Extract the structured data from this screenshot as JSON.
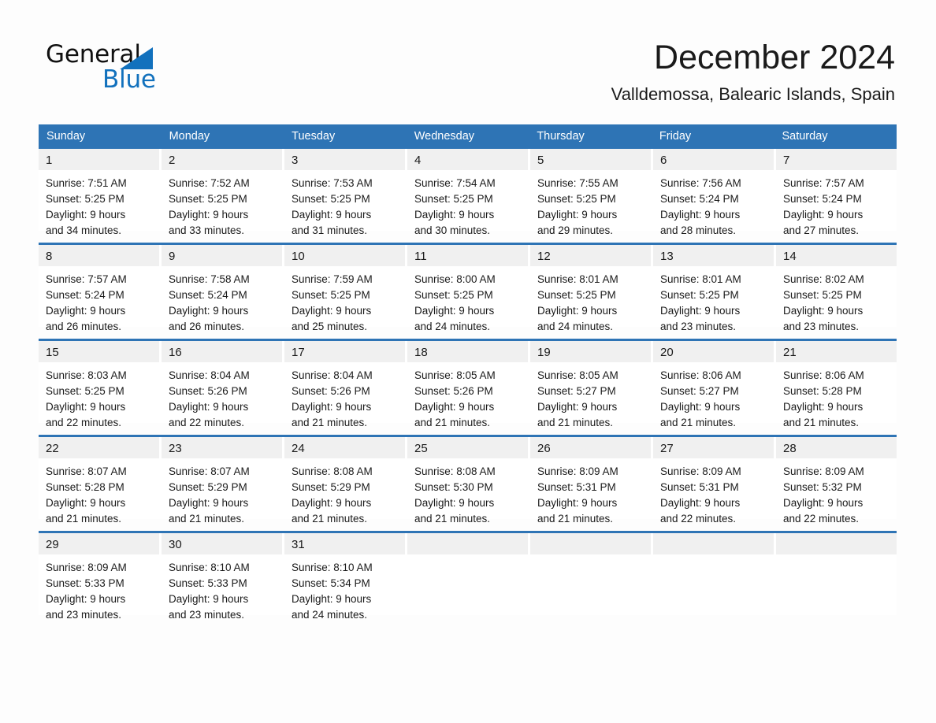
{
  "logo": {
    "text_primary": "General",
    "text_secondary": "Blue",
    "accent_color": "#1271bd",
    "triangle_icon": "triangle-icon"
  },
  "header": {
    "month_title": "December 2024",
    "location": "Valldemossa, Balearic Islands, Spain"
  },
  "colors": {
    "header_blue": "#2e74b5",
    "date_band_gray": "#f0f0f0",
    "page_background": "#fdfdfd",
    "text": "#1a1a1a"
  },
  "calendar": {
    "weekdays": [
      "Sunday",
      "Monday",
      "Tuesday",
      "Wednesday",
      "Thursday",
      "Friday",
      "Saturday"
    ],
    "weeks": [
      [
        {
          "date": "1",
          "sunrise": "Sunrise: 7:51 AM",
          "sunset": "Sunset: 5:25 PM",
          "daylight_line1": "Daylight: 9 hours",
          "daylight_line2": "and 34 minutes."
        },
        {
          "date": "2",
          "sunrise": "Sunrise: 7:52 AM",
          "sunset": "Sunset: 5:25 PM",
          "daylight_line1": "Daylight: 9 hours",
          "daylight_line2": "and 33 minutes."
        },
        {
          "date": "3",
          "sunrise": "Sunrise: 7:53 AM",
          "sunset": "Sunset: 5:25 PM",
          "daylight_line1": "Daylight: 9 hours",
          "daylight_line2": "and 31 minutes."
        },
        {
          "date": "4",
          "sunrise": "Sunrise: 7:54 AM",
          "sunset": "Sunset: 5:25 PM",
          "daylight_line1": "Daylight: 9 hours",
          "daylight_line2": "and 30 minutes."
        },
        {
          "date": "5",
          "sunrise": "Sunrise: 7:55 AM",
          "sunset": "Sunset: 5:25 PM",
          "daylight_line1": "Daylight: 9 hours",
          "daylight_line2": "and 29 minutes."
        },
        {
          "date": "6",
          "sunrise": "Sunrise: 7:56 AM",
          "sunset": "Sunset: 5:24 PM",
          "daylight_line1": "Daylight: 9 hours",
          "daylight_line2": "and 28 minutes."
        },
        {
          "date": "7",
          "sunrise": "Sunrise: 7:57 AM",
          "sunset": "Sunset: 5:24 PM",
          "daylight_line1": "Daylight: 9 hours",
          "daylight_line2": "and 27 minutes."
        }
      ],
      [
        {
          "date": "8",
          "sunrise": "Sunrise: 7:57 AM",
          "sunset": "Sunset: 5:24 PM",
          "daylight_line1": "Daylight: 9 hours",
          "daylight_line2": "and 26 minutes."
        },
        {
          "date": "9",
          "sunrise": "Sunrise: 7:58 AM",
          "sunset": "Sunset: 5:24 PM",
          "daylight_line1": "Daylight: 9 hours",
          "daylight_line2": "and 26 minutes."
        },
        {
          "date": "10",
          "sunrise": "Sunrise: 7:59 AM",
          "sunset": "Sunset: 5:25 PM",
          "daylight_line1": "Daylight: 9 hours",
          "daylight_line2": "and 25 minutes."
        },
        {
          "date": "11",
          "sunrise": "Sunrise: 8:00 AM",
          "sunset": "Sunset: 5:25 PM",
          "daylight_line1": "Daylight: 9 hours",
          "daylight_line2": "and 24 minutes."
        },
        {
          "date": "12",
          "sunrise": "Sunrise: 8:01 AM",
          "sunset": "Sunset: 5:25 PM",
          "daylight_line1": "Daylight: 9 hours",
          "daylight_line2": "and 24 minutes."
        },
        {
          "date": "13",
          "sunrise": "Sunrise: 8:01 AM",
          "sunset": "Sunset: 5:25 PM",
          "daylight_line1": "Daylight: 9 hours",
          "daylight_line2": "and 23 minutes."
        },
        {
          "date": "14",
          "sunrise": "Sunrise: 8:02 AM",
          "sunset": "Sunset: 5:25 PM",
          "daylight_line1": "Daylight: 9 hours",
          "daylight_line2": "and 23 minutes."
        }
      ],
      [
        {
          "date": "15",
          "sunrise": "Sunrise: 8:03 AM",
          "sunset": "Sunset: 5:25 PM",
          "daylight_line1": "Daylight: 9 hours",
          "daylight_line2": "and 22 minutes."
        },
        {
          "date": "16",
          "sunrise": "Sunrise: 8:04 AM",
          "sunset": "Sunset: 5:26 PM",
          "daylight_line1": "Daylight: 9 hours",
          "daylight_line2": "and 22 minutes."
        },
        {
          "date": "17",
          "sunrise": "Sunrise: 8:04 AM",
          "sunset": "Sunset: 5:26 PM",
          "daylight_line1": "Daylight: 9 hours",
          "daylight_line2": "and 21 minutes."
        },
        {
          "date": "18",
          "sunrise": "Sunrise: 8:05 AM",
          "sunset": "Sunset: 5:26 PM",
          "daylight_line1": "Daylight: 9 hours",
          "daylight_line2": "and 21 minutes."
        },
        {
          "date": "19",
          "sunrise": "Sunrise: 8:05 AM",
          "sunset": "Sunset: 5:27 PM",
          "daylight_line1": "Daylight: 9 hours",
          "daylight_line2": "and 21 minutes."
        },
        {
          "date": "20",
          "sunrise": "Sunrise: 8:06 AM",
          "sunset": "Sunset: 5:27 PM",
          "daylight_line1": "Daylight: 9 hours",
          "daylight_line2": "and 21 minutes."
        },
        {
          "date": "21",
          "sunrise": "Sunrise: 8:06 AM",
          "sunset": "Sunset: 5:28 PM",
          "daylight_line1": "Daylight: 9 hours",
          "daylight_line2": "and 21 minutes."
        }
      ],
      [
        {
          "date": "22",
          "sunrise": "Sunrise: 8:07 AM",
          "sunset": "Sunset: 5:28 PM",
          "daylight_line1": "Daylight: 9 hours",
          "daylight_line2": "and 21 minutes."
        },
        {
          "date": "23",
          "sunrise": "Sunrise: 8:07 AM",
          "sunset": "Sunset: 5:29 PM",
          "daylight_line1": "Daylight: 9 hours",
          "daylight_line2": "and 21 minutes."
        },
        {
          "date": "24",
          "sunrise": "Sunrise: 8:08 AM",
          "sunset": "Sunset: 5:29 PM",
          "daylight_line1": "Daylight: 9 hours",
          "daylight_line2": "and 21 minutes."
        },
        {
          "date": "25",
          "sunrise": "Sunrise: 8:08 AM",
          "sunset": "Sunset: 5:30 PM",
          "daylight_line1": "Daylight: 9 hours",
          "daylight_line2": "and 21 minutes."
        },
        {
          "date": "26",
          "sunrise": "Sunrise: 8:09 AM",
          "sunset": "Sunset: 5:31 PM",
          "daylight_line1": "Daylight: 9 hours",
          "daylight_line2": "and 21 minutes."
        },
        {
          "date": "27",
          "sunrise": "Sunrise: 8:09 AM",
          "sunset": "Sunset: 5:31 PM",
          "daylight_line1": "Daylight: 9 hours",
          "daylight_line2": "and 22 minutes."
        },
        {
          "date": "28",
          "sunrise": "Sunrise: 8:09 AM",
          "sunset": "Sunset: 5:32 PM",
          "daylight_line1": "Daylight: 9 hours",
          "daylight_line2": "and 22 minutes."
        }
      ],
      [
        {
          "date": "29",
          "sunrise": "Sunrise: 8:09 AM",
          "sunset": "Sunset: 5:33 PM",
          "daylight_line1": "Daylight: 9 hours",
          "daylight_line2": "and 23 minutes."
        },
        {
          "date": "30",
          "sunrise": "Sunrise: 8:10 AM",
          "sunset": "Sunset: 5:33 PM",
          "daylight_line1": "Daylight: 9 hours",
          "daylight_line2": "and 23 minutes."
        },
        {
          "date": "31",
          "sunrise": "Sunrise: 8:10 AM",
          "sunset": "Sunset: 5:34 PM",
          "daylight_line1": "Daylight: 9 hours",
          "daylight_line2": "and 24 minutes."
        },
        {
          "date": "",
          "sunrise": "",
          "sunset": "",
          "daylight_line1": "",
          "daylight_line2": ""
        },
        {
          "date": "",
          "sunrise": "",
          "sunset": "",
          "daylight_line1": "",
          "daylight_line2": ""
        },
        {
          "date": "",
          "sunrise": "",
          "sunset": "",
          "daylight_line1": "",
          "daylight_line2": ""
        },
        {
          "date": "",
          "sunrise": "",
          "sunset": "",
          "daylight_line1": "",
          "daylight_line2": ""
        }
      ]
    ]
  }
}
